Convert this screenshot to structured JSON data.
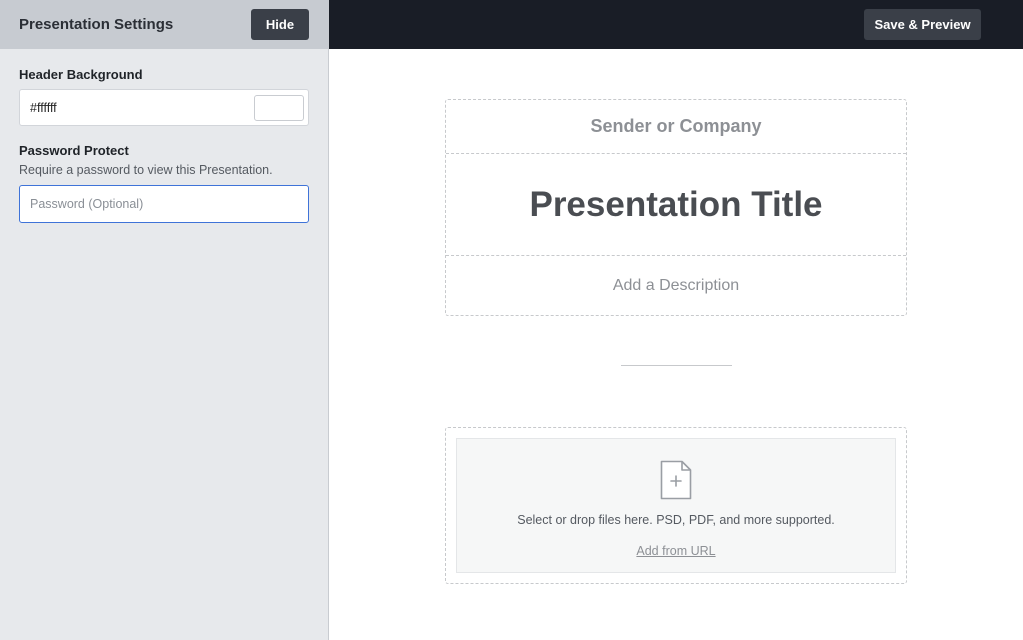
{
  "sidebar": {
    "title": "Presentation Settings",
    "hide_label": "Hide",
    "header_background": {
      "label": "Header Background",
      "value": "#ffffff",
      "swatch_color": "#ffffff"
    },
    "password": {
      "label": "Password Protect",
      "help": "Require a password to view this Presentation.",
      "placeholder": "Password (Optional)"
    }
  },
  "topbar": {
    "save_label": "Save & Preview"
  },
  "header_card": {
    "sender": "Sender or Company",
    "title": "Presentation Title",
    "description": "Add a Description"
  },
  "upload": {
    "icon": "file-add-icon",
    "text": "Select or drop files here. PSD, PDF, and more supported.",
    "link_label": "Add from URL"
  },
  "colors": {
    "sidebar_bg": "#e7e9ec",
    "sidebar_header_bg": "#c7cbd1",
    "topbar_bg": "#191d26",
    "button_bg": "#3a3f48",
    "focus_border": "#3f73d8"
  }
}
